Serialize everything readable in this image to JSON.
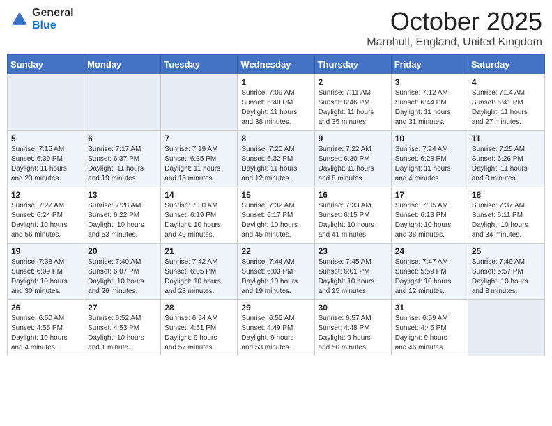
{
  "header": {
    "logo_general": "General",
    "logo_blue": "Blue",
    "month_title": "October 2025",
    "location": "Marnhull, England, United Kingdom"
  },
  "days_of_week": [
    "Sunday",
    "Monday",
    "Tuesday",
    "Wednesday",
    "Thursday",
    "Friday",
    "Saturday"
  ],
  "weeks": [
    [
      {
        "day": "",
        "content": ""
      },
      {
        "day": "",
        "content": ""
      },
      {
        "day": "",
        "content": ""
      },
      {
        "day": "1",
        "content": "Sunrise: 7:09 AM\nSunset: 6:48 PM\nDaylight: 11 hours\nand 38 minutes."
      },
      {
        "day": "2",
        "content": "Sunrise: 7:11 AM\nSunset: 6:46 PM\nDaylight: 11 hours\nand 35 minutes."
      },
      {
        "day": "3",
        "content": "Sunrise: 7:12 AM\nSunset: 6:44 PM\nDaylight: 11 hours\nand 31 minutes."
      },
      {
        "day": "4",
        "content": "Sunrise: 7:14 AM\nSunset: 6:41 PM\nDaylight: 11 hours\nand 27 minutes."
      }
    ],
    [
      {
        "day": "5",
        "content": "Sunrise: 7:15 AM\nSunset: 6:39 PM\nDaylight: 11 hours\nand 23 minutes."
      },
      {
        "day": "6",
        "content": "Sunrise: 7:17 AM\nSunset: 6:37 PM\nDaylight: 11 hours\nand 19 minutes."
      },
      {
        "day": "7",
        "content": "Sunrise: 7:19 AM\nSunset: 6:35 PM\nDaylight: 11 hours\nand 15 minutes."
      },
      {
        "day": "8",
        "content": "Sunrise: 7:20 AM\nSunset: 6:32 PM\nDaylight: 11 hours\nand 12 minutes."
      },
      {
        "day": "9",
        "content": "Sunrise: 7:22 AM\nSunset: 6:30 PM\nDaylight: 11 hours\nand 8 minutes."
      },
      {
        "day": "10",
        "content": "Sunrise: 7:24 AM\nSunset: 6:28 PM\nDaylight: 11 hours\nand 4 minutes."
      },
      {
        "day": "11",
        "content": "Sunrise: 7:25 AM\nSunset: 6:26 PM\nDaylight: 11 hours\nand 0 minutes."
      }
    ],
    [
      {
        "day": "12",
        "content": "Sunrise: 7:27 AM\nSunset: 6:24 PM\nDaylight: 10 hours\nand 56 minutes."
      },
      {
        "day": "13",
        "content": "Sunrise: 7:28 AM\nSunset: 6:22 PM\nDaylight: 10 hours\nand 53 minutes."
      },
      {
        "day": "14",
        "content": "Sunrise: 7:30 AM\nSunset: 6:19 PM\nDaylight: 10 hours\nand 49 minutes."
      },
      {
        "day": "15",
        "content": "Sunrise: 7:32 AM\nSunset: 6:17 PM\nDaylight: 10 hours\nand 45 minutes."
      },
      {
        "day": "16",
        "content": "Sunrise: 7:33 AM\nSunset: 6:15 PM\nDaylight: 10 hours\nand 41 minutes."
      },
      {
        "day": "17",
        "content": "Sunrise: 7:35 AM\nSunset: 6:13 PM\nDaylight: 10 hours\nand 38 minutes."
      },
      {
        "day": "18",
        "content": "Sunrise: 7:37 AM\nSunset: 6:11 PM\nDaylight: 10 hours\nand 34 minutes."
      }
    ],
    [
      {
        "day": "19",
        "content": "Sunrise: 7:38 AM\nSunset: 6:09 PM\nDaylight: 10 hours\nand 30 minutes."
      },
      {
        "day": "20",
        "content": "Sunrise: 7:40 AM\nSunset: 6:07 PM\nDaylight: 10 hours\nand 26 minutes."
      },
      {
        "day": "21",
        "content": "Sunrise: 7:42 AM\nSunset: 6:05 PM\nDaylight: 10 hours\nand 23 minutes."
      },
      {
        "day": "22",
        "content": "Sunrise: 7:44 AM\nSunset: 6:03 PM\nDaylight: 10 hours\nand 19 minutes."
      },
      {
        "day": "23",
        "content": "Sunrise: 7:45 AM\nSunset: 6:01 PM\nDaylight: 10 hours\nand 15 minutes."
      },
      {
        "day": "24",
        "content": "Sunrise: 7:47 AM\nSunset: 5:59 PM\nDaylight: 10 hours\nand 12 minutes."
      },
      {
        "day": "25",
        "content": "Sunrise: 7:49 AM\nSunset: 5:57 PM\nDaylight: 10 hours\nand 8 minutes."
      }
    ],
    [
      {
        "day": "26",
        "content": "Sunrise: 6:50 AM\nSunset: 4:55 PM\nDaylight: 10 hours\nand 4 minutes."
      },
      {
        "day": "27",
        "content": "Sunrise: 6:52 AM\nSunset: 4:53 PM\nDaylight: 10 hours\nand 1 minute."
      },
      {
        "day": "28",
        "content": "Sunrise: 6:54 AM\nSunset: 4:51 PM\nDaylight: 9 hours\nand 57 minutes."
      },
      {
        "day": "29",
        "content": "Sunrise: 6:55 AM\nSunset: 4:49 PM\nDaylight: 9 hours\nand 53 minutes."
      },
      {
        "day": "30",
        "content": "Sunrise: 6:57 AM\nSunset: 4:48 PM\nDaylight: 9 hours\nand 50 minutes."
      },
      {
        "day": "31",
        "content": "Sunrise: 6:59 AM\nSunset: 4:46 PM\nDaylight: 9 hours\nand 46 minutes."
      },
      {
        "day": "",
        "content": ""
      }
    ]
  ]
}
